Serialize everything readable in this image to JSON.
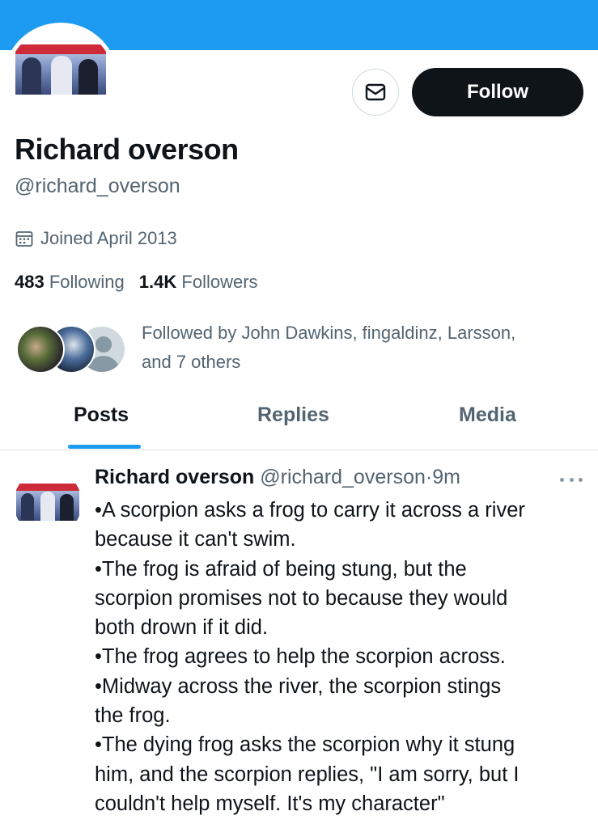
{
  "profile": {
    "display_name": "Richard overson",
    "handle": "@richard_overson",
    "joined": "Joined April 2013",
    "following_count": "483",
    "following_label": "Following",
    "followers_count": "1.4K",
    "followers_label": "Followers",
    "follow_button_label": "Follow",
    "followed_by_line1": "Followed by John Dawkins, fingaldinz, Larsson,",
    "followed_by_line2": "and 7 others"
  },
  "tabs": [
    {
      "label": "Posts",
      "active": true
    },
    {
      "label": "Replies",
      "active": false
    },
    {
      "label": "Media",
      "active": false
    }
  ],
  "tweet": {
    "name": "Richard overson",
    "handle": "@richard_overson",
    "separator": "·",
    "time": "9m",
    "lines": [
      "•A scorpion asks a frog to carry it across a river",
      "because it can't swim.",
      "•The frog is afraid of being stung, but the",
      "scorpion promises not to because they would",
      "both drown if it did.",
      "•The frog agrees to help the scorpion across.",
      "•Midway across the river, the scorpion stings",
      "the frog.",
      "•The dying frog asks the scorpion why it stung",
      "him, and the scorpion replies, \"I am sorry, but I",
      "couldn't help myself. It's my character\""
    ]
  },
  "colors": {
    "banner": "#1d9bf0",
    "accent": "#1d9bf0",
    "follow_button": "#0f1419",
    "secondary_text": "#536471"
  },
  "icons": [
    "mail-icon",
    "calendar-icon",
    "more-icon"
  ]
}
